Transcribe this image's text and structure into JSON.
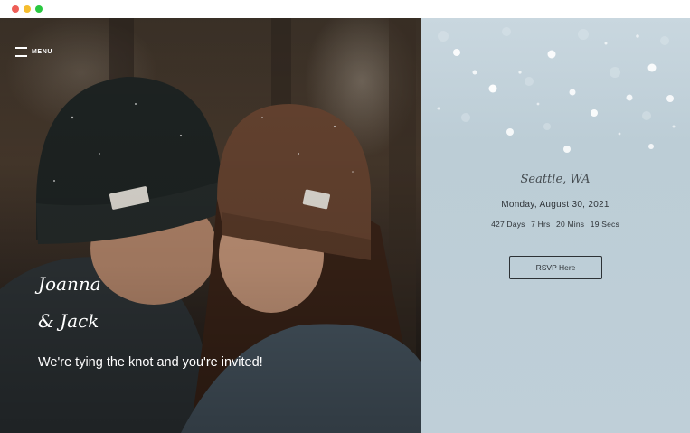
{
  "browser": {
    "buttons": [
      "close",
      "minimize",
      "maximize"
    ],
    "colors": {
      "close": "#ee5e57",
      "minimize": "#f5bd2e",
      "maximize": "#29c840"
    }
  },
  "hero": {
    "menu_label": "MENU",
    "menu_icon": "hamburger-icon",
    "name_line1": "Joanna",
    "name_line2": "& Jack",
    "tagline": "We're tying the knot and you're invited!"
  },
  "info": {
    "location": "Seattle, WA",
    "date": "Monday, August 30, 2021",
    "countdown": {
      "days": "427 Days",
      "hours": "7 Hrs",
      "mins": "20 Mins",
      "secs": "19 Secs"
    },
    "rsvp_label": "RSVP Here",
    "background_color": "#c0d0d9"
  }
}
